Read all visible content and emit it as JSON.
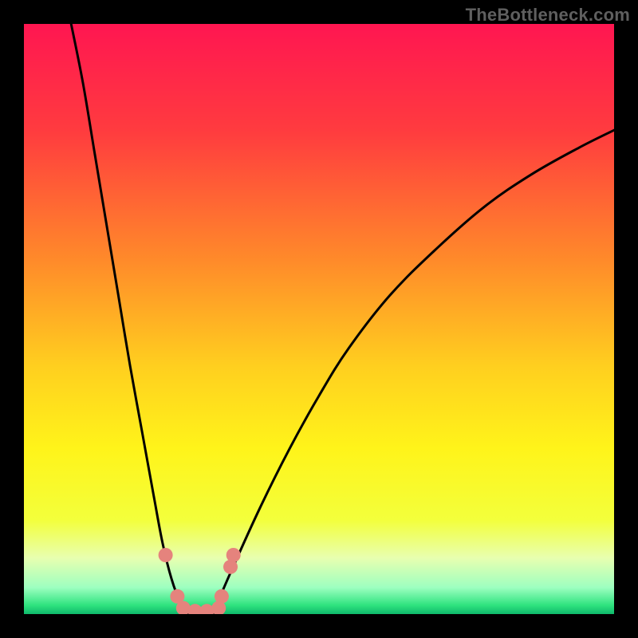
{
  "watermark": "TheBottleneck.com",
  "chart_data": {
    "type": "line",
    "title": "",
    "xlabel": "",
    "ylabel": "",
    "xlim": [
      0,
      100
    ],
    "ylim": [
      0,
      100
    ],
    "grid": false,
    "legend": false,
    "series": [
      {
        "name": "left-curve",
        "x": [
          8,
          10,
          12,
          14,
          16,
          18,
          20,
          22,
          23.5,
          25,
          26.5,
          28
        ],
        "values": [
          100,
          90,
          78,
          66,
          54,
          42,
          31,
          20,
          12,
          6,
          2,
          0
        ]
      },
      {
        "name": "right-curve",
        "x": [
          32,
          35,
          40,
          45,
          50,
          55,
          62,
          70,
          78,
          86,
          94,
          100
        ],
        "values": [
          0,
          7,
          18,
          28,
          37,
          45,
          54,
          62,
          69,
          74.5,
          79,
          82
        ]
      }
    ],
    "scatter_points": [
      {
        "x": 24,
        "y": 10
      },
      {
        "x": 26,
        "y": 3
      },
      {
        "x": 27,
        "y": 1
      },
      {
        "x": 29,
        "y": 0.5
      },
      {
        "x": 31,
        "y": 0.5
      },
      {
        "x": 33,
        "y": 1
      },
      {
        "x": 33.5,
        "y": 3
      },
      {
        "x": 35,
        "y": 8
      },
      {
        "x": 35.5,
        "y": 10
      }
    ],
    "gradient_stops": [
      {
        "offset": 0,
        "color": "#ff1651"
      },
      {
        "offset": 0.18,
        "color": "#ff3b3f"
      },
      {
        "offset": 0.4,
        "color": "#ff8a2a"
      },
      {
        "offset": 0.58,
        "color": "#ffcf1f"
      },
      {
        "offset": 0.72,
        "color": "#fff41a"
      },
      {
        "offset": 0.84,
        "color": "#f3ff3b"
      },
      {
        "offset": 0.905,
        "color": "#e8ffb0"
      },
      {
        "offset": 0.955,
        "color": "#9dffc0"
      },
      {
        "offset": 0.985,
        "color": "#2fe37f"
      },
      {
        "offset": 1.0,
        "color": "#0fb96b"
      }
    ],
    "colors": {
      "curve": "#000000",
      "marker": "#e5837d",
      "frame": "#000000"
    }
  }
}
